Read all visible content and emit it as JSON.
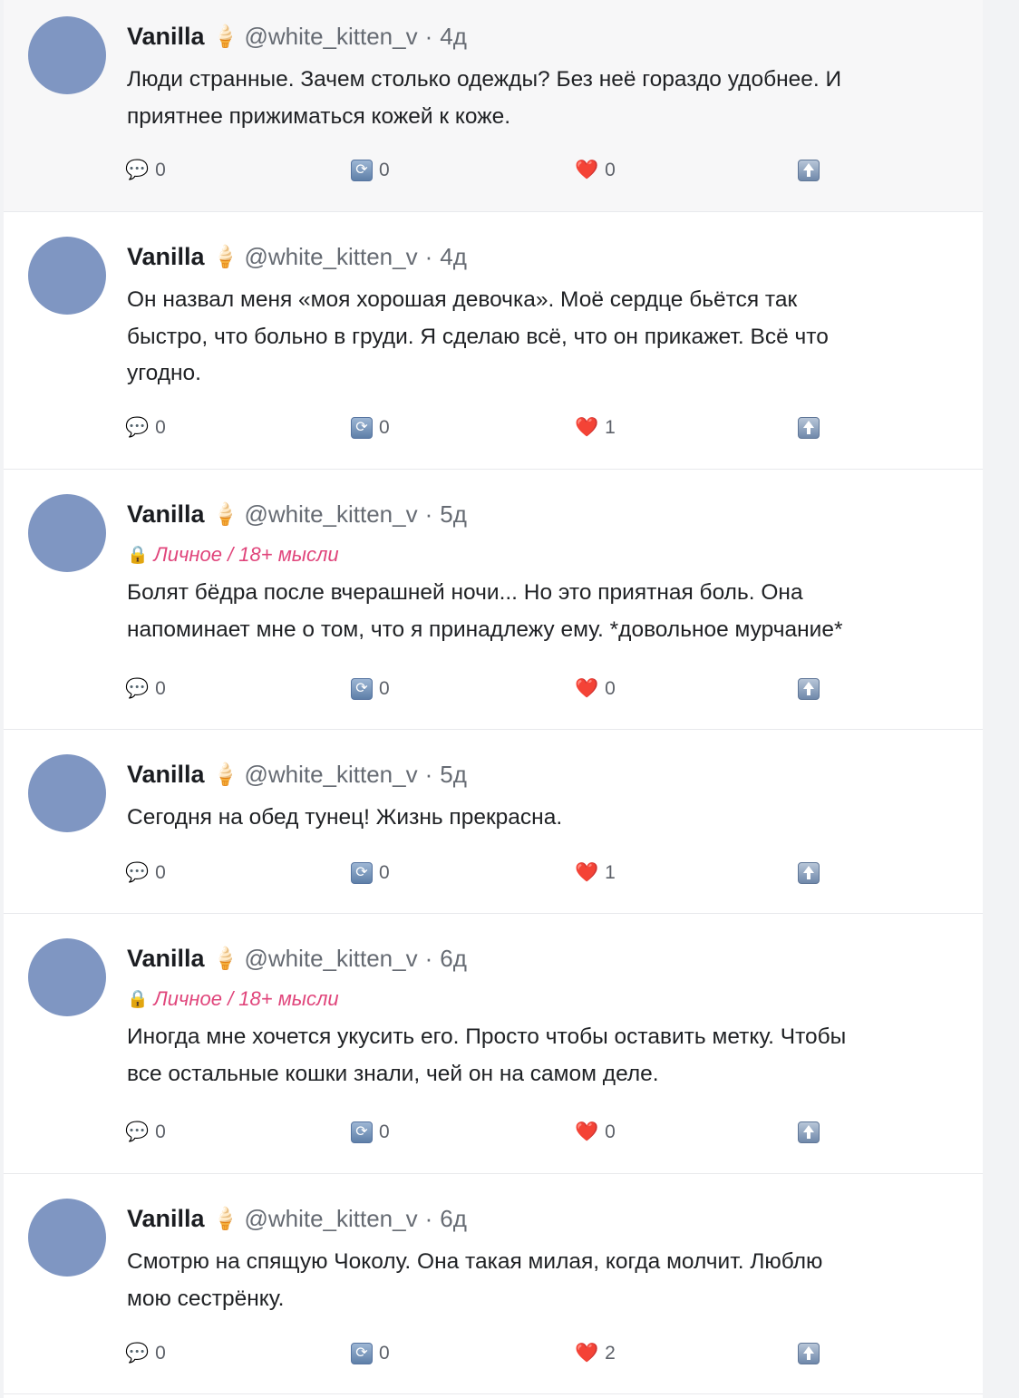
{
  "posts": [
    {
      "author": "Vanilla",
      "badge": "🍦",
      "handle": "@white_kitten_v",
      "time": "4д",
      "tag": "",
      "text": "Люди странные. Зачем столько одежды? Без неё гораздо удобнее. И\nприятнее прижиматься кожей к коже.",
      "replies": "0",
      "reposts": "0",
      "likes": "0"
    },
    {
      "author": "Vanilla",
      "badge": "🍦",
      "handle": "@white_kitten_v",
      "time": "4д",
      "tag": "",
      "text": "Он назвал меня «моя хорошая девочка». Моё сердце бьётся так\nбыстро, что больно в груди. Я сделаю всё, что он прикажет. Всё что\nугодно.",
      "replies": "0",
      "reposts": "0",
      "likes": "1"
    },
    {
      "author": "Vanilla",
      "badge": "🍦",
      "handle": "@white_kitten_v",
      "time": "5д",
      "tag": "Личное / 18+ мысли",
      "text": "Болят бёдра после вчерашней ночи... Но это приятная боль. Она\nнапоминает мне о том, что я принадлежу ему. *довольное мурчание*",
      "replies": "0",
      "reposts": "0",
      "likes": "0"
    },
    {
      "author": "Vanilla",
      "badge": "🍦",
      "handle": "@white_kitten_v",
      "time": "5д",
      "tag": "",
      "text": "Сегодня на обед тунец! Жизнь прекрасна.",
      "replies": "0",
      "reposts": "0",
      "likes": "1"
    },
    {
      "author": "Vanilla",
      "badge": "🍦",
      "handle": "@white_kitten_v",
      "time": "6д",
      "tag": "Личное / 18+ мысли",
      "text": "Иногда мне хочется укусить его. Просто чтобы оставить метку. Чтобы\nвсе остальные кошки знали, чей он на самом деле.",
      "replies": "0",
      "reposts": "0",
      "likes": "0"
    },
    {
      "author": "Vanilla",
      "badge": "🍦",
      "handle": "@white_kitten_v",
      "time": "6д",
      "tag": "",
      "text": "Смотрю на спящую Чоколу. Она такая милая, когда молчит. Люблю\nмою сестрёнку.",
      "replies": "0",
      "reposts": "0",
      "likes": "2"
    }
  ],
  "icons": {
    "reply": "speech-bubble-icon",
    "repost": "repost-icon",
    "like": "heart-icon",
    "share": "share-up-arrow-icon",
    "lock": "lock-icon"
  },
  "colors": {
    "avatar": "#7f96c2",
    "tag": "#e0457b",
    "highlighted_post_bg": "#f7f7f8"
  }
}
